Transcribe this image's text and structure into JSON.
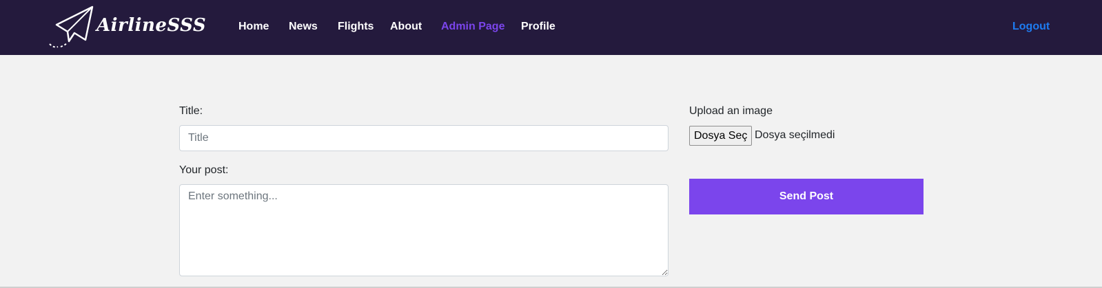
{
  "brand": {
    "name": "AirlineSSS",
    "logo_icon": "paper-plane-icon"
  },
  "nav": {
    "items": [
      {
        "label": "Home"
      },
      {
        "label": "News"
      },
      {
        "label": "Flights"
      },
      {
        "label": "About"
      },
      {
        "label": "Admin Page",
        "active": true
      },
      {
        "label": "Profile"
      }
    ],
    "logout_label": "Logout"
  },
  "form": {
    "title_label": "Title:",
    "title_placeholder": "Title",
    "post_label": "Your post:",
    "post_placeholder": "Enter something...",
    "upload_label": "Upload an image",
    "file_button_label": "Dosya Seç",
    "file_status": "Dosya seçilmedi",
    "submit_label": "Send Post"
  },
  "colors": {
    "navbar_bg": "#241a3d",
    "accent": "#7b45ec",
    "logout": "#1e7cf2",
    "page_bg": "#f2f2f2"
  }
}
